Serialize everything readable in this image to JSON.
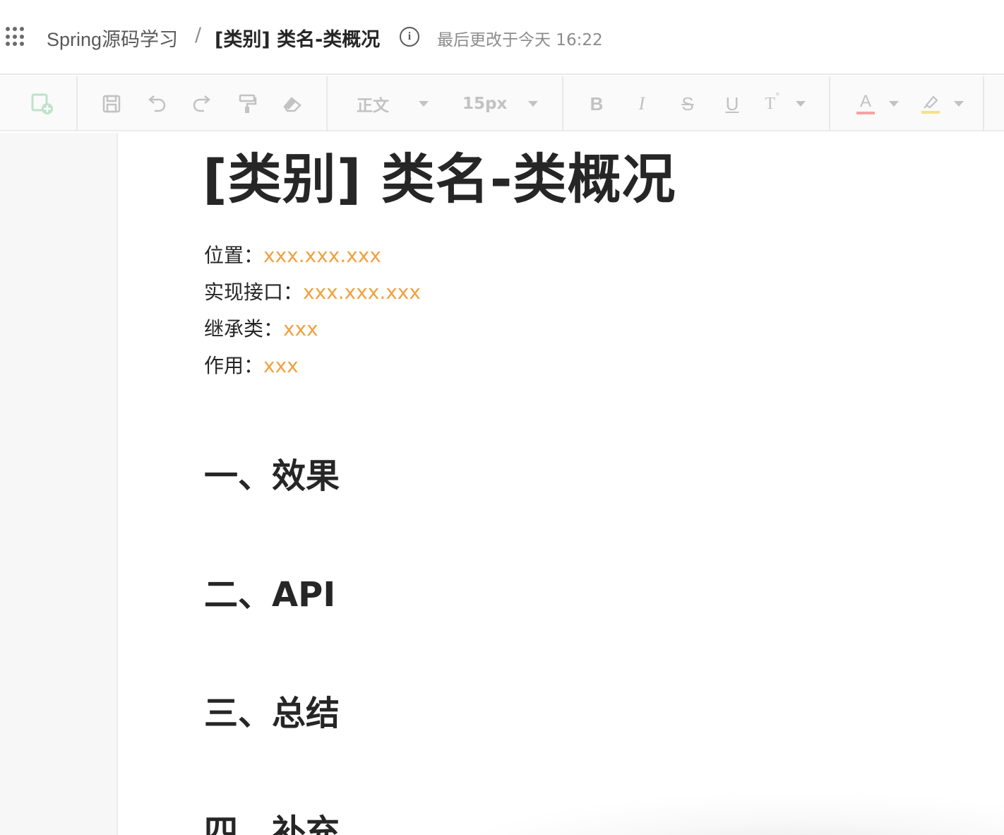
{
  "header": {
    "breadcrumb_root": "Spring源码学习",
    "breadcrumb_sep": "/",
    "breadcrumb_current": "[类别] 类名-类概况",
    "last_modified": "最后更改于今天 16:22"
  },
  "toolbar": {
    "paragraph_style": "正文",
    "font_size": "15px",
    "icons": [
      "new-doc-icon",
      "save-icon",
      "undo-icon",
      "redo-icon",
      "format-painter-icon",
      "eraser-icon",
      "bold-icon",
      "italic-icon",
      "strikethrough-icon",
      "underline-icon",
      "superscript-icon",
      "font-color-icon",
      "highlight-icon"
    ],
    "font_color_underline": "#f5a3a3",
    "highlight_underline": "#f7e08a"
  },
  "document": {
    "title": "[类别] 类名-类概况",
    "meta": [
      {
        "label": "位置：",
        "value": "xxx.xxx.xxx"
      },
      {
        "label": "实现接口：",
        "value": "xxx.xxx.xxx"
      },
      {
        "label": "继承类：",
        "value": "xxx"
      },
      {
        "label": "作用：",
        "value": "xxx"
      }
    ],
    "sections": [
      "一、效果",
      "二、API",
      "三、总结",
      "四、补充"
    ],
    "accent_color": "#f0a240"
  }
}
